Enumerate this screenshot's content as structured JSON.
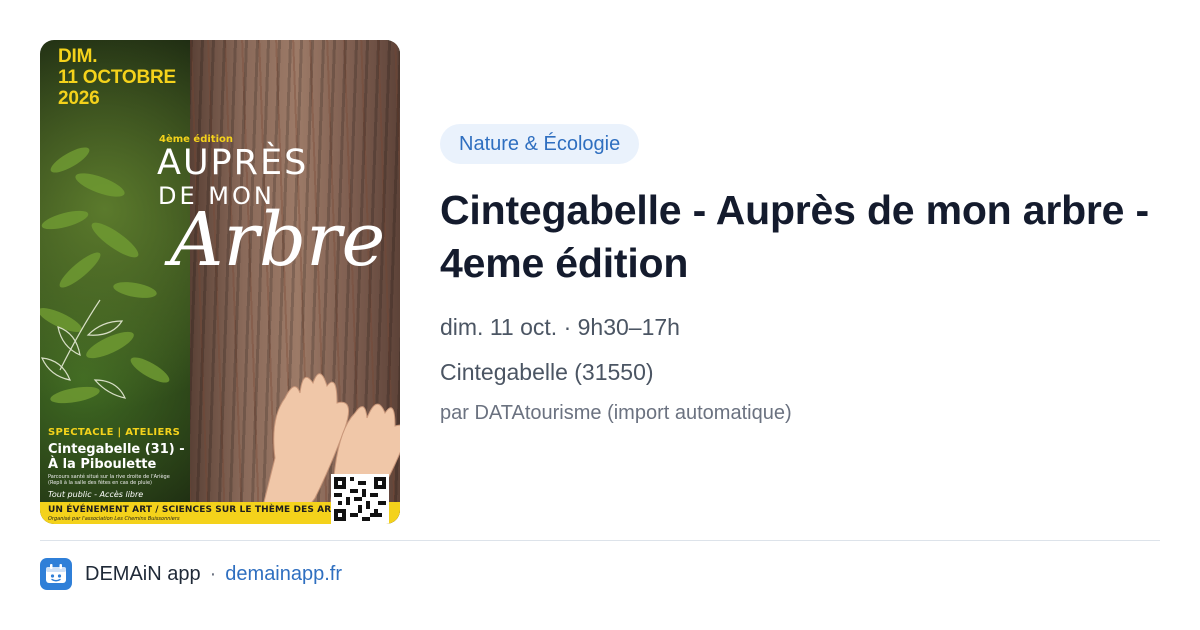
{
  "poster": {
    "date_line1": "DIM.",
    "date_line2": "11 OCTOBRE",
    "date_line3": "2026",
    "edition": "4ème édition",
    "title_line1": "AUPRÈS",
    "title_line2": "DE MON",
    "title_script": "Arbre",
    "activities": "SPECTACLE | ATELIERS",
    "place_line1": "Cintegabelle (31) -",
    "place_line2": "À la Piboulette",
    "small_line1": "Parcours santé situé sur la rive droite de l'Ariège",
    "small_line2": "(Repli à la salle des fêtes en cas de pluie)",
    "audience": "Tout public - Accès libre",
    "banner_main": "UN ÉVÉNEMENT ART / SCIENCES SUR LE THÈME DES ARBRES",
    "banner_sub": "Organisé par l'association Les Chemins Buissonniers"
  },
  "event": {
    "category": "Nature & Écologie",
    "title": "Cintegabelle - Auprès de mon arbre - 4eme édition",
    "when": "dim. 11 oct. · 9h30–17h",
    "where": "Cintegabelle (31550)",
    "source": "par DATAtourisme (import automatique)"
  },
  "footer": {
    "app_name": "DEMAiN app",
    "separator": "·",
    "domain": "demainapp.fr",
    "icon": "demain-app-logo-icon"
  },
  "colors": {
    "poster_yellow": "#f4d21b",
    "category_bg": "#eaf2fc",
    "category_text": "#2f6fc0",
    "link": "#2f6fc0",
    "title": "#141b2d",
    "meta": "#4b5563",
    "app_icon": "#2f7fd8"
  }
}
